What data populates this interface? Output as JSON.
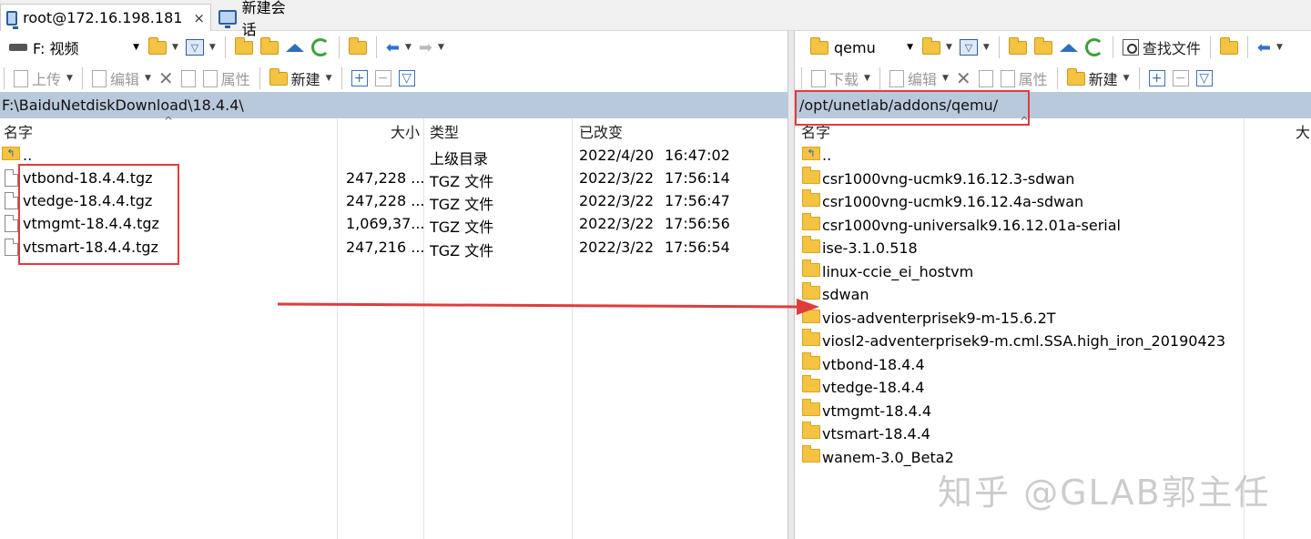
{
  "tabs": [
    {
      "label": "root@172.16.198.181",
      "close": "×"
    },
    {
      "label": "新建会话"
    }
  ],
  "left": {
    "drive_label": "F: 视频",
    "toolbar2": {
      "upload": "上传",
      "edit": "编辑",
      "props": "属性",
      "new": "新建"
    },
    "path": "F:\\BaiduNetdiskDownload\\18.4.4\\",
    "columns": {
      "name": "名字",
      "size": "大小",
      "type": "类型",
      "modified": "已改变"
    },
    "rows": [
      {
        "name": "..",
        "size": "",
        "type": "上级目录",
        "date": "2022/4/20",
        "time": "16:47:02"
      },
      {
        "name": "vtbond-18.4.4.tgz",
        "size": "247,228 ...",
        "type": "TGZ 文件",
        "date": "2022/3/22",
        "time": "17:56:14"
      },
      {
        "name": "vtedge-18.4.4.tgz",
        "size": "247,228 ...",
        "type": "TGZ 文件",
        "date": "2022/3/22",
        "time": "17:56:47"
      },
      {
        "name": "vtmgmt-18.4.4.tgz",
        "size": "1,069,37...",
        "type": "TGZ 文件",
        "date": "2022/3/22",
        "time": "17:56:56"
      },
      {
        "name": "vtsmart-18.4.4.tgz",
        "size": "247,216 ...",
        "type": "TGZ 文件",
        "date": "2022/3/22",
        "time": "17:56:54"
      }
    ]
  },
  "right": {
    "folder_label": "qemu",
    "find_label": "查找文件",
    "toolbar2": {
      "download": "下载",
      "edit": "编辑",
      "props": "属性",
      "new": "新建"
    },
    "path": "/opt/unetlab/addons/qemu/",
    "columns": {
      "name": "名字",
      "size": "大"
    },
    "rows": [
      {
        "name": ".."
      },
      {
        "name": "csr1000vng-ucmk9.16.12.3-sdwan"
      },
      {
        "name": "csr1000vng-ucmk9.16.12.4a-sdwan"
      },
      {
        "name": "csr1000vng-universalk9.16.12.01a-serial"
      },
      {
        "name": "ise-3.1.0.518"
      },
      {
        "name": "linux-ccie_ei_hostvm"
      },
      {
        "name": "sdwan"
      },
      {
        "name": "vios-adventerprisek9-m-15.6.2T"
      },
      {
        "name": "viosl2-adventerprisek9-m.cml.SSA.high_iron_20190423"
      },
      {
        "name": "vtbond-18.4.4"
      },
      {
        "name": "vtedge-18.4.4"
      },
      {
        "name": "vtmgmt-18.4.4"
      },
      {
        "name": "vtsmart-18.4.4"
      },
      {
        "name": "wanem-3.0_Beta2"
      }
    ]
  },
  "watermark": "知乎 @GLAB郭主任",
  "colors": {
    "annotation": "#e03c3c",
    "pathbar": "#b9c9dc",
    "folder": "#f5c342"
  }
}
